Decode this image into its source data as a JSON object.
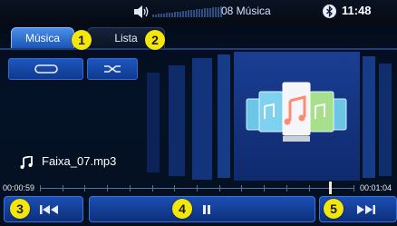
{
  "status_bar": {
    "volume_icon": "volume-icon",
    "track_count": "08 Música",
    "bluetooth_icon": "bluetooth-icon",
    "time": "11:48"
  },
  "tabs": [
    {
      "label": "Música",
      "active": true
    },
    {
      "label": "Lista",
      "active": false
    }
  ],
  "callouts": [
    "1",
    "2",
    "3",
    "4",
    "5"
  ],
  "controls": {
    "repeat_icon": "repeat-icon",
    "shuffle_icon": "shuffle-icon"
  },
  "now_playing": {
    "note_icon": "music-note-icon",
    "track_name": "Faixa_07.mp3"
  },
  "progress": {
    "elapsed": "00:00:59",
    "total": "00:01:04",
    "fraction": 0.922
  },
  "transport": {
    "prev_icon": "skip-previous-icon",
    "play_pause_icon": "pause-icon",
    "next_icon": "skip-next-icon"
  },
  "colors": {
    "accent": "#1a55b5",
    "callout": "#f2e60b",
    "background": "#041228"
  }
}
